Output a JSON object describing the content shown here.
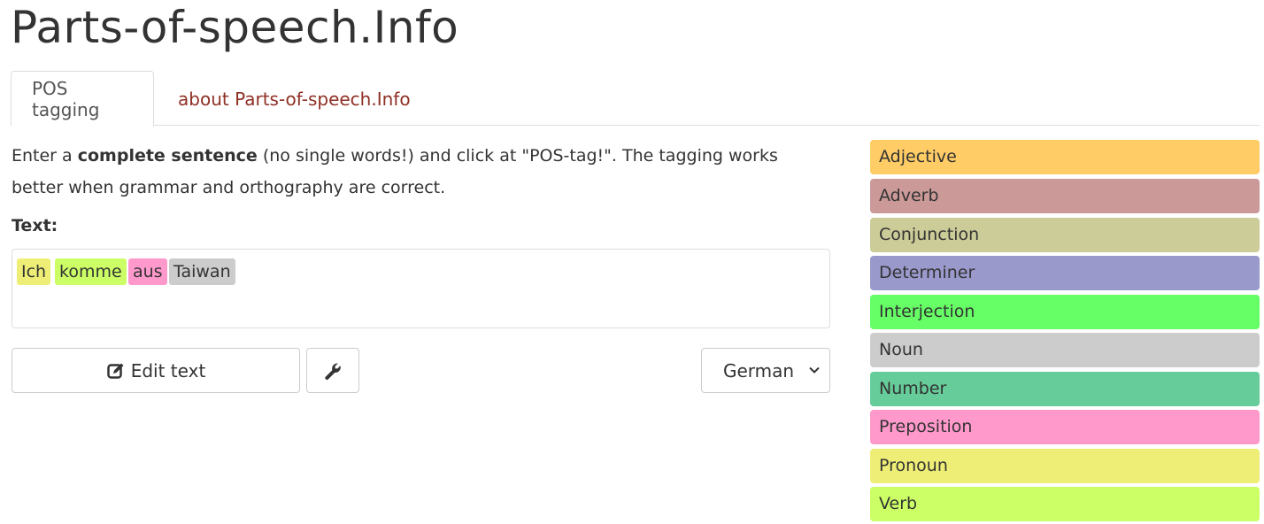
{
  "site": {
    "title": "Parts-of-speech.Info"
  },
  "tabs": [
    {
      "label": "POS tagging",
      "active": true
    },
    {
      "label": "about Parts-of-speech.Info",
      "active": false
    }
  ],
  "intro": {
    "part1": "Enter a ",
    "bold": "complete sentence",
    "part2": " (no single words!) and click at \"POS-tag!\". The tagging works better when grammar and orthography are correct."
  },
  "text_label": "Text:",
  "tokens": [
    {
      "word": "Ich",
      "pos": "Pronoun",
      "color": "#eeee77"
    },
    {
      "word": "komme",
      "pos": "Verb",
      "color": "#ccff66"
    },
    {
      "word": "aus",
      "pos": "Preposition",
      "color": "#ff99cc"
    },
    {
      "word": "Taiwan",
      "pos": "Noun",
      "color": "#cccccc"
    }
  ],
  "buttons": {
    "edit_label": "Edit text",
    "edit_icon": "edit-icon",
    "tools_icon": "wrench-icon"
  },
  "language": {
    "selected": "German"
  },
  "legend": [
    {
      "label": "Adjective",
      "color": "#ffcc66"
    },
    {
      "label": "Adverb",
      "color": "#cc9999"
    },
    {
      "label": "Conjunction",
      "color": "#cccc99"
    },
    {
      "label": "Determiner",
      "color": "#9999cc"
    },
    {
      "label": "Interjection",
      "color": "#66ff66"
    },
    {
      "label": "Noun",
      "color": "#cccccc"
    },
    {
      "label": "Number",
      "color": "#66cc99"
    },
    {
      "label": "Preposition",
      "color": "#ff99cc"
    },
    {
      "label": "Pronoun",
      "color": "#eeee77"
    },
    {
      "label": "Verb",
      "color": "#ccff66"
    }
  ]
}
